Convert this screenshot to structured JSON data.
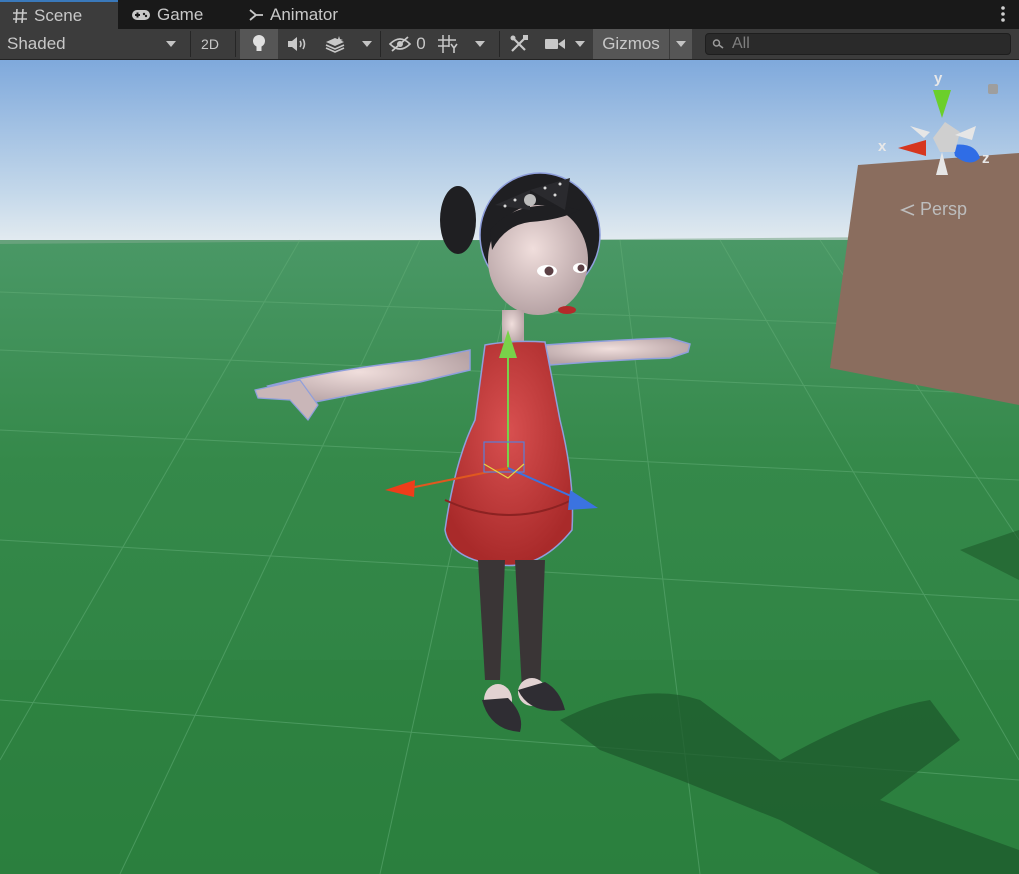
{
  "tabs": [
    {
      "label": "Scene",
      "icon": "grid-hash-icon",
      "active": true
    },
    {
      "label": "Game",
      "icon": "gamepad-icon",
      "active": false
    },
    {
      "label": "Animator",
      "icon": "animator-icon",
      "active": false
    }
  ],
  "toolbar": {
    "shading_mode": "Shaded",
    "mode_2d": "2D",
    "hidden_count": "0",
    "gizmos_label": "Gizmos",
    "search_placeholder": "All"
  },
  "scene_gizmo": {
    "projection_label": "Persp",
    "axis_x": "x",
    "axis_y": "y",
    "axis_z": "z",
    "colors": {
      "x": "#d6361e",
      "y": "#6bcf2a",
      "z": "#2f6de6"
    }
  },
  "icons": [
    "kebab-menu-icon",
    "lightbulb-icon",
    "audio-icon",
    "effects-icon",
    "visibility-icon",
    "grid-icon",
    "tools-icon",
    "camera-icon",
    "search-icon",
    "lock-icon"
  ]
}
